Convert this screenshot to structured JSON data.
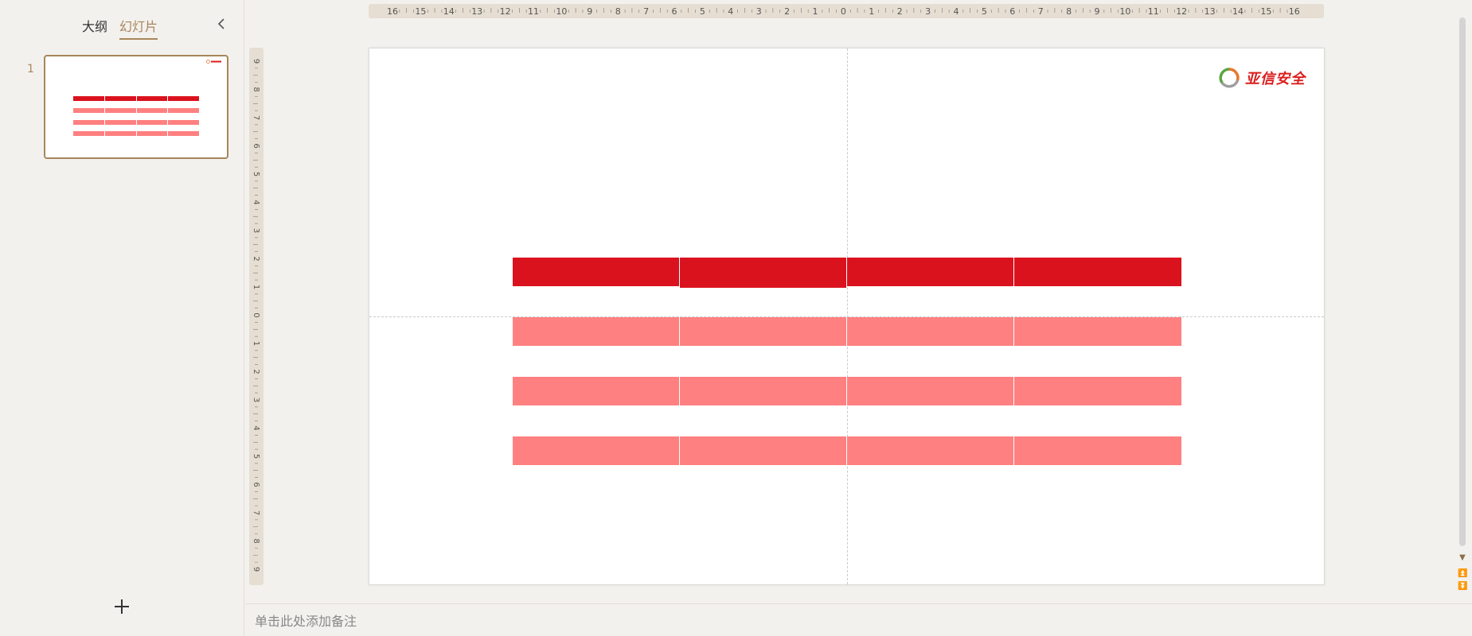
{
  "panel": {
    "tabs": [
      {
        "label": "大纲",
        "active": false
      },
      {
        "label": "幻灯片",
        "active": true
      }
    ],
    "slide_number": "1"
  },
  "ruler": {
    "top_ticks": [
      "16",
      "15",
      "14",
      "13",
      "12",
      "11",
      "10",
      "9",
      "8",
      "7",
      "6",
      "5",
      "4",
      "3",
      "2",
      "1",
      "0",
      "1",
      "2",
      "3",
      "4",
      "5",
      "6",
      "7",
      "8",
      "9",
      "10",
      "11",
      "12",
      "13",
      "14",
      "15",
      "16"
    ],
    "left_ticks": [
      "9",
      "8",
      "7",
      "6",
      "5",
      "4",
      "3",
      "2",
      "1",
      "0",
      "1",
      "2",
      "3",
      "4",
      "5",
      "6",
      "7",
      "8",
      "9"
    ]
  },
  "slide": {
    "logo_text": "亚信安全",
    "table": {
      "columns": 4,
      "header_rows": 1,
      "body_rows": 3,
      "header_color": "#da121e",
      "body_color": "#ff8080"
    }
  },
  "notes": {
    "placeholder": "单击此处添加备注"
  },
  "colors": {
    "accent": "#a8865a",
    "brand_red": "#dc1d1d"
  },
  "icons": {
    "collapse": "chevron-left-icon",
    "add_slide": "plus-icon",
    "scroll_down": "triangle-down-icon",
    "prev_page": "double-chevron-up-icon",
    "next_page": "double-chevron-down-icon"
  }
}
